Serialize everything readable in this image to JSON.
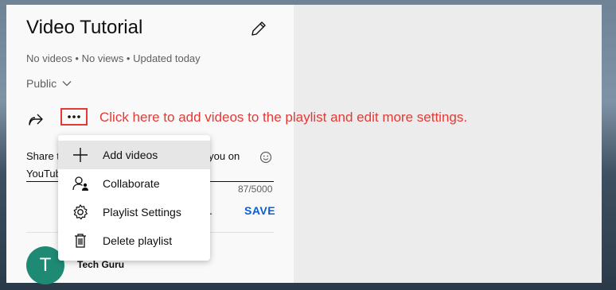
{
  "playlist": {
    "title": "Video Tutorial",
    "meta": "No videos • No views • Updated today",
    "privacy": "Public"
  },
  "annotation": "Click here to add videos to the playlist and edit more settings.",
  "description": {
    "line1_left": "Share t",
    "line1_right": "or you on",
    "line2_left": "YouTub",
    "counter": "87/5000"
  },
  "actions": {
    "cancel_partial": "L",
    "save": "SAVE"
  },
  "channel": {
    "avatar_letter": "T",
    "name": "Tech Guru",
    "avatar_color": "#1e8a74"
  },
  "menu": {
    "items": [
      {
        "label": "Add videos",
        "icon": "plus-icon"
      },
      {
        "label": "Collaborate",
        "icon": "collaborate-icon"
      },
      {
        "label": "Playlist Settings",
        "icon": "gear-icon"
      },
      {
        "label": "Delete playlist",
        "icon": "trash-icon"
      }
    ]
  },
  "colors": {
    "annotation": "#e53935",
    "save": "#065fd4"
  }
}
